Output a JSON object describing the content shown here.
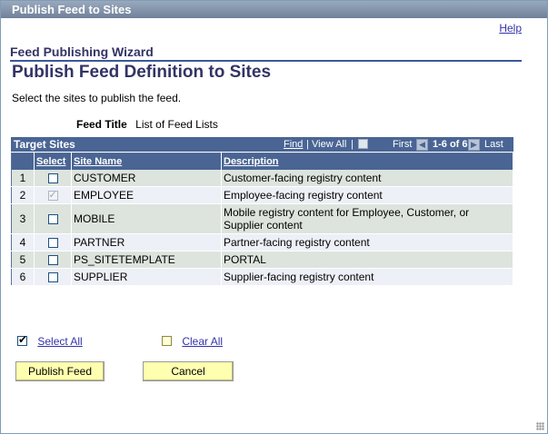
{
  "window": {
    "title": "Publish Feed to Sites"
  },
  "help_link": "Help",
  "wizard_title": "Feed Publishing Wizard",
  "page_title": "Publish Feed Definition to Sites",
  "instruction": "Select the sites to publish the feed.",
  "feed": {
    "label": "Feed Title",
    "value": "List of Feed Lists"
  },
  "grid": {
    "title": "Target Sites",
    "nav": {
      "find": "Find",
      "separator": "|",
      "view_all": "View All",
      "first": "First",
      "range": "1-6 of 6",
      "last": "Last"
    },
    "columns": {
      "select": "Select",
      "site_name": "Site Name",
      "description": "Description"
    },
    "rows": [
      {
        "num": "1",
        "site": "CUSTOMER",
        "description": "Customer-facing registry content",
        "checked": false,
        "disabled": false
      },
      {
        "num": "2",
        "site": "EMPLOYEE",
        "description": "Employee-facing registry content",
        "checked": true,
        "disabled": true
      },
      {
        "num": "3",
        "site": "MOBILE",
        "description": "Mobile registry content for Employee, Customer, or Supplier content",
        "checked": false,
        "disabled": false
      },
      {
        "num": "4",
        "site": "PARTNER",
        "description": "Partner-facing registry content",
        "checked": false,
        "disabled": false
      },
      {
        "num": "5",
        "site": "PS_SITETEMPLATE",
        "description": "PORTAL",
        "checked": false,
        "disabled": false
      },
      {
        "num": "6",
        "site": "SUPPLIER",
        "description": "Supplier-facing registry content",
        "checked": false,
        "disabled": false
      }
    ]
  },
  "select_all": "Select All",
  "clear_all": "Clear All",
  "buttons": {
    "publish": "Publish Feed",
    "cancel": "Cancel"
  },
  "colors": {
    "header_bg": "#4a6594",
    "title_color": "#333366",
    "button_bg": "#ffffb0",
    "link": "#3333aa"
  }
}
